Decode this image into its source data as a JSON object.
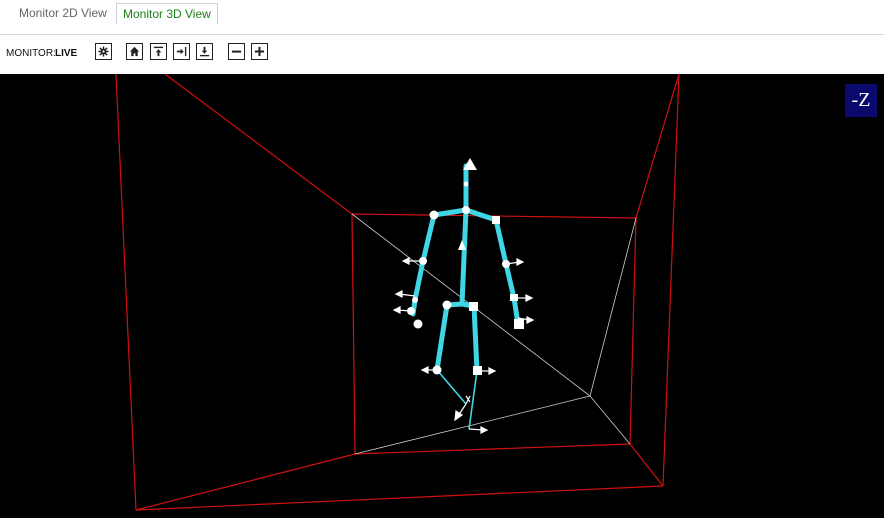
{
  "tabs": [
    {
      "label": "Monitor 2D View",
      "active": false
    },
    {
      "label": "Monitor 3D View",
      "active": true
    }
  ],
  "toolbar": {
    "monitor_label": "MONITOR:",
    "monitor_value": "LIVE",
    "buttons": [
      "settings-icon",
      "home-icon",
      "top-view-icon",
      "side-view-icon",
      "bottom-view-icon",
      "zoom-out-icon",
      "zoom-in-icon"
    ]
  },
  "viewport": {
    "axis_label": "-Z",
    "colors": {
      "background": "#000000",
      "room_edges": "#d01010",
      "floor_lines": "#cfcfcf",
      "skeleton": "#3fd6e6",
      "joints": "#ffffff"
    }
  }
}
